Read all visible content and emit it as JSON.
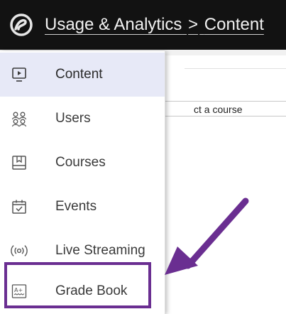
{
  "header": {
    "breadcrumb_parent": "Usage & Analytics",
    "breadcrumb_separator": ">",
    "breadcrumb_current": "Content"
  },
  "page": {
    "course_select_text": "ct a course"
  },
  "menu": {
    "items": [
      {
        "label": "Content",
        "icon": "content-icon",
        "active": true
      },
      {
        "label": "Users",
        "icon": "users-icon"
      },
      {
        "label": "Courses",
        "icon": "courses-icon"
      },
      {
        "label": "Events",
        "icon": "events-icon"
      },
      {
        "label": "Live Streaming",
        "icon": "live-streaming-icon"
      },
      {
        "label": "Grade Book",
        "icon": "grade-book-icon"
      }
    ]
  },
  "colors": {
    "header_bg": "#121212",
    "active_item_bg": "#e7e9f7",
    "annotation_purple": "#6a2e91"
  }
}
